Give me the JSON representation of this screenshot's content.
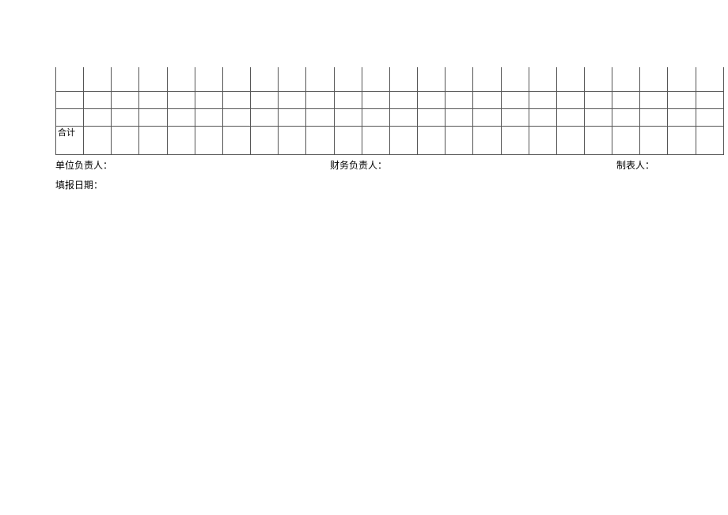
{
  "table": {
    "total_label": "合计",
    "columns": 24,
    "rows": [
      {
        "type": "partial",
        "cells": [
          "",
          "",
          "",
          "",
          "",
          "",
          "",
          "",
          "",
          "",
          "",
          "",
          "",
          "",
          "",
          "",
          "",
          "",
          "",
          "",
          "",
          "",
          "",
          ""
        ]
      },
      {
        "type": "data",
        "cells": [
          "",
          "",
          "",
          "",
          "",
          "",
          "",
          "",
          "",
          "",
          "",
          "",
          "",
          "",
          "",
          "",
          "",
          "",
          "",
          "",
          "",
          "",
          "",
          ""
        ]
      },
      {
        "type": "data",
        "cells": [
          "",
          "",
          "",
          "",
          "",
          "",
          "",
          "",
          "",
          "",
          "",
          "",
          "",
          "",
          "",
          "",
          "",
          "",
          "",
          "",
          "",
          "",
          "",
          ""
        ]
      },
      {
        "type": "total",
        "cells": [
          "",
          "",
          "",
          "",
          "",
          "",
          "",
          "",
          "",
          "",
          "",
          "",
          "",
          "",
          "",
          "",
          "",
          "",
          "",
          "",
          "",
          "",
          "",
          ""
        ]
      }
    ]
  },
  "footer": {
    "unit_leader": "单位负责人：",
    "finance_leader": "财务负责人：",
    "preparer": "制表人：",
    "report_date": "填报日期："
  }
}
